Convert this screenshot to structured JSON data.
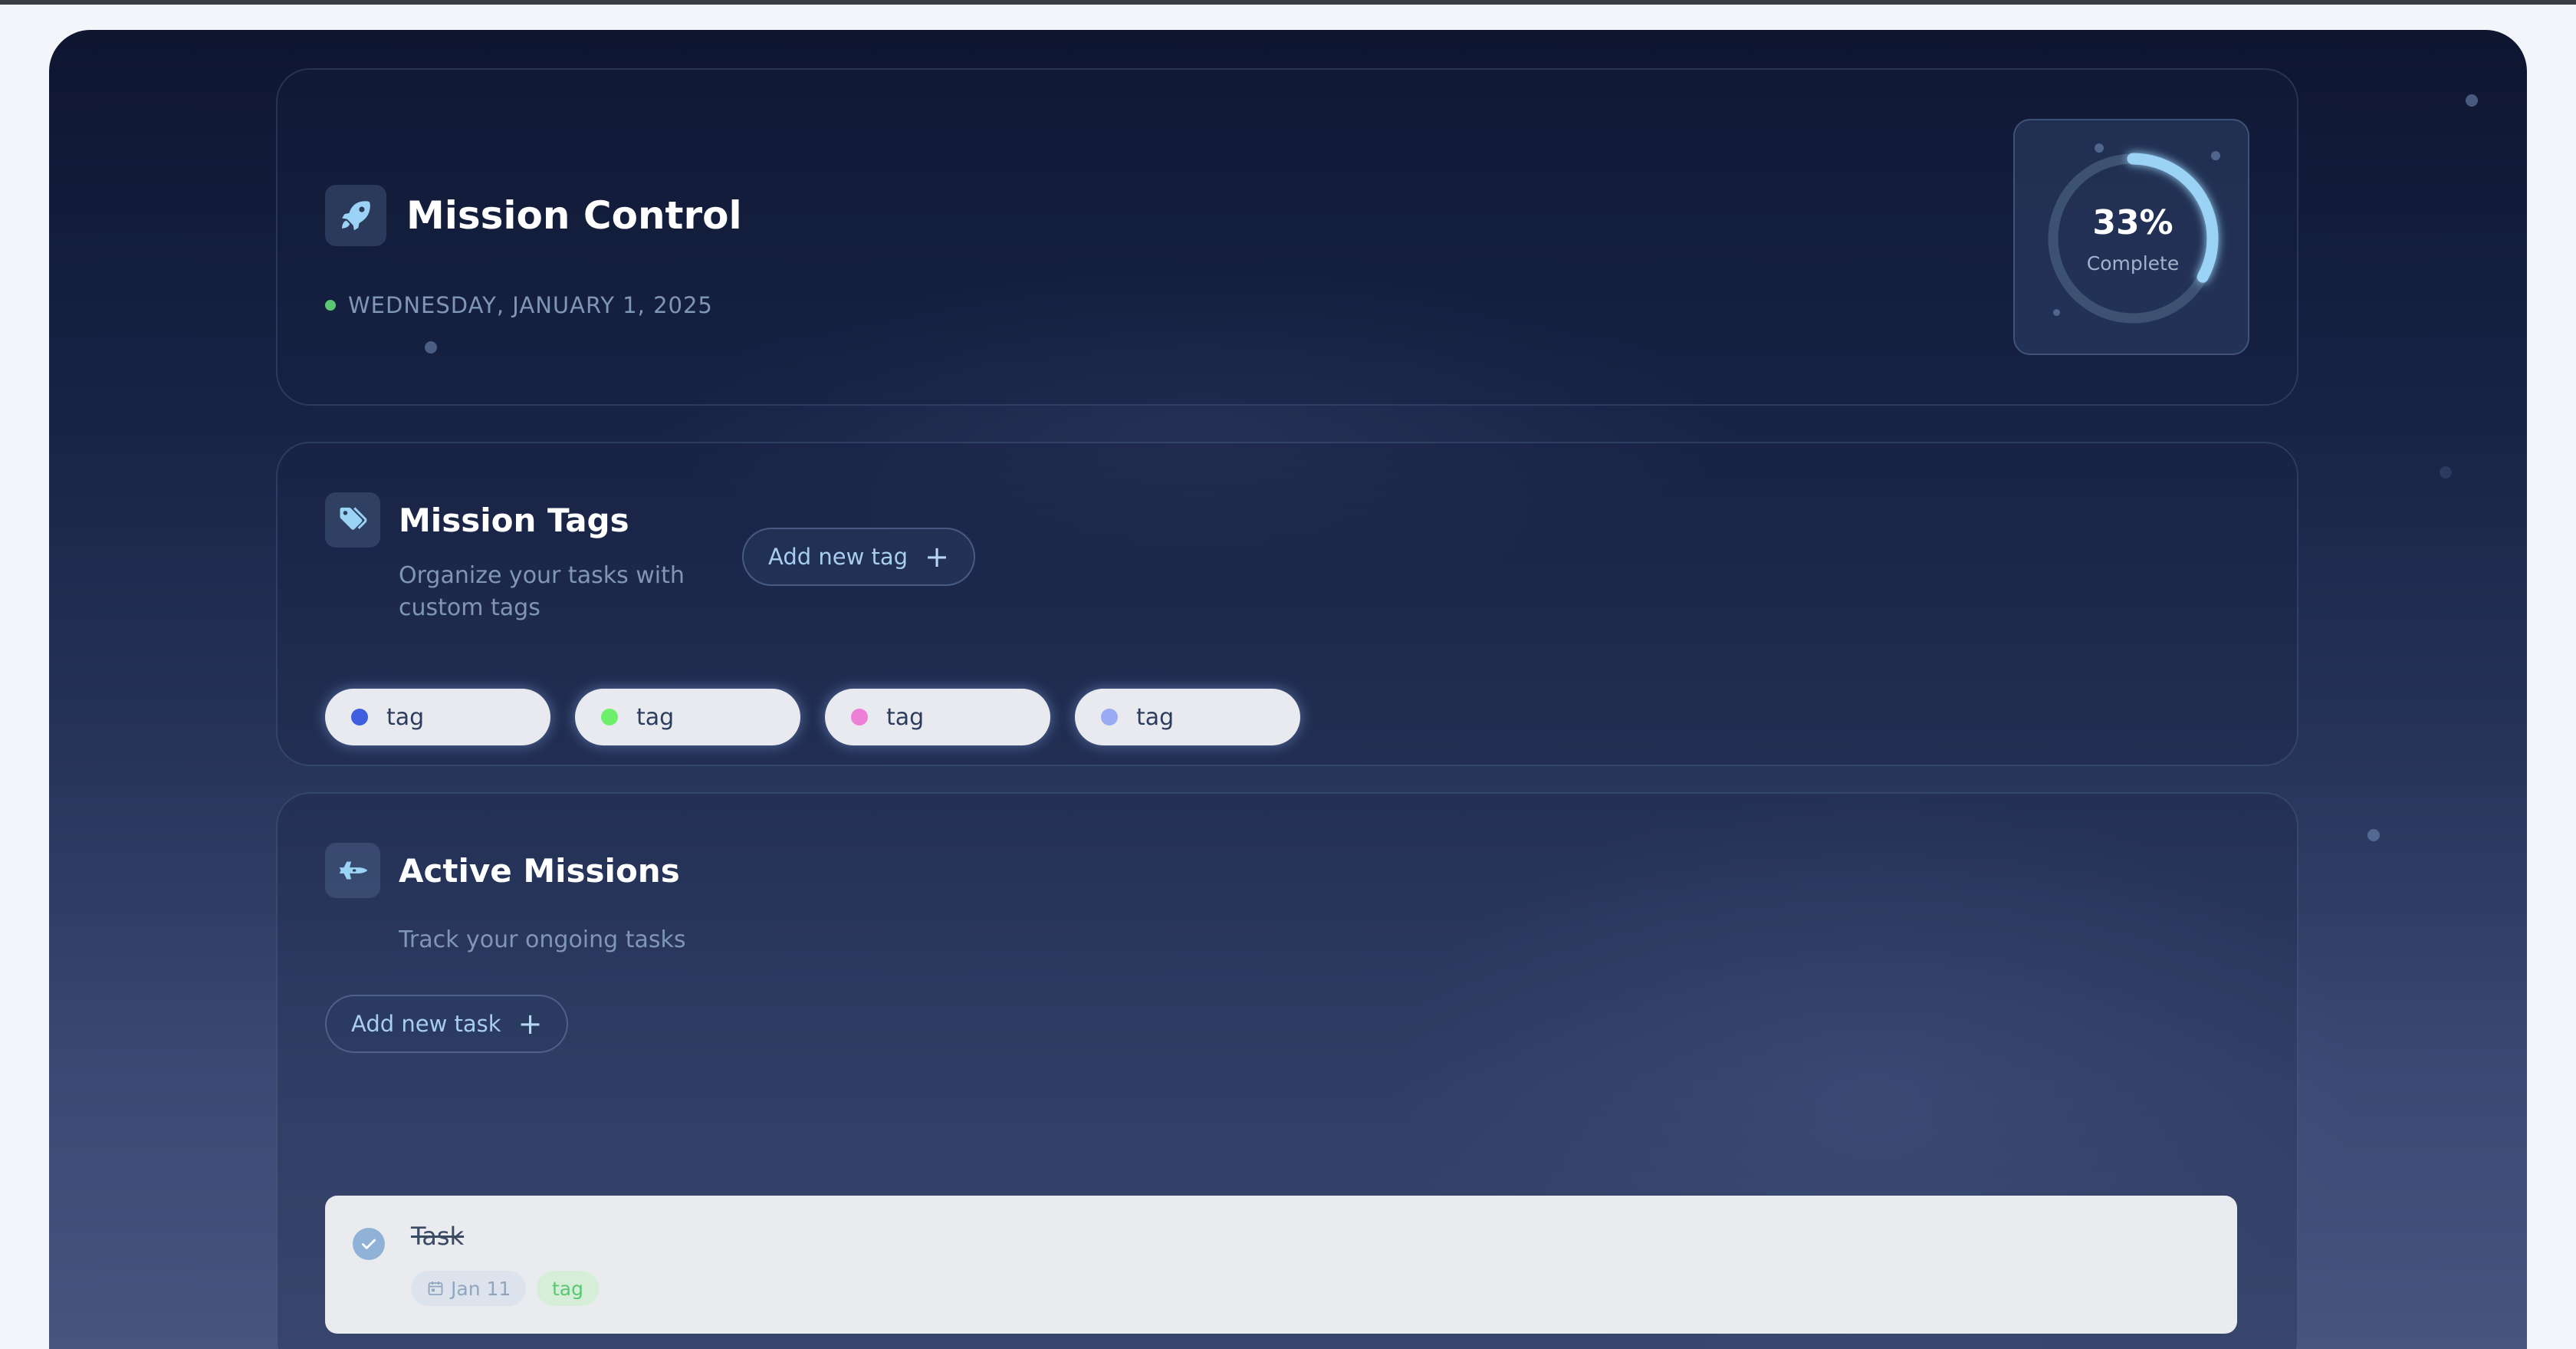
{
  "header": {
    "title": "Mission Control",
    "date": "WEDNESDAY, JANUARY 1, 2025",
    "icon": "rocket-icon"
  },
  "progress": {
    "value_text": "33%",
    "label": "Complete",
    "fraction": 0.33,
    "track_color": "#3d5273",
    "arc_color": "#9ad3f5"
  },
  "tags_section": {
    "title": "Mission Tags",
    "subtitle_lines": [
      "Organize your tasks with",
      "custom tags"
    ],
    "add_button": "Add new tag",
    "icon": "tag-icon",
    "tags": [
      {
        "label": "tag",
        "color": "#3d5fe0"
      },
      {
        "label": "tag",
        "color": "#6cf06c"
      },
      {
        "label": "tag",
        "color": "#ee7fd6"
      },
      {
        "label": "tag",
        "color": "#9aaaf5"
      }
    ]
  },
  "missions_section": {
    "title": "Active Missions",
    "subtitle": "Track your ongoing tasks",
    "add_button": "Add new task",
    "icon": "shuttle-icon",
    "tasks": [
      {
        "title": "Task",
        "date": "Jan 11",
        "tag": "tag",
        "completed": true
      }
    ]
  },
  "colors": {
    "accent": "#9ad3f5",
    "success": "#5ac873",
    "text_muted": "#7f96b4"
  }
}
